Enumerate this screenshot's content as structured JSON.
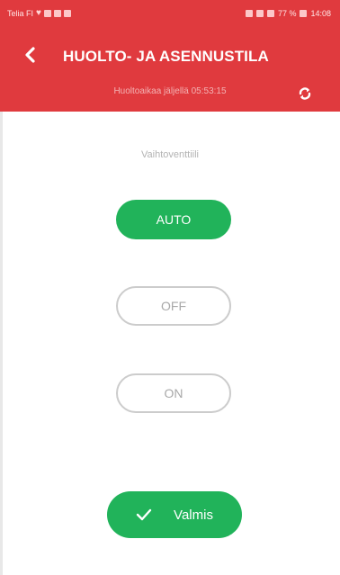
{
  "statusbar": {
    "carrier": "Telia FI",
    "time": "14:08",
    "battery": "77 %"
  },
  "header": {
    "title": "HUOLTO- JA ASENNUSTILA",
    "subtitle": "Huoltoaikaa jäljellä 05:53:15"
  },
  "main": {
    "section_label": "Vaihtoventtiili",
    "options": [
      {
        "label": "AUTO",
        "selected": true
      },
      {
        "label": "OFF",
        "selected": false
      },
      {
        "label": "ON",
        "selected": false
      }
    ],
    "done_label": "Valmis"
  },
  "colors": {
    "header": "#e03a3e",
    "accent": "#21b35a"
  },
  "icons": {
    "back": "chevron-left-icon",
    "refresh": "refresh-icon",
    "done": "check-icon"
  }
}
